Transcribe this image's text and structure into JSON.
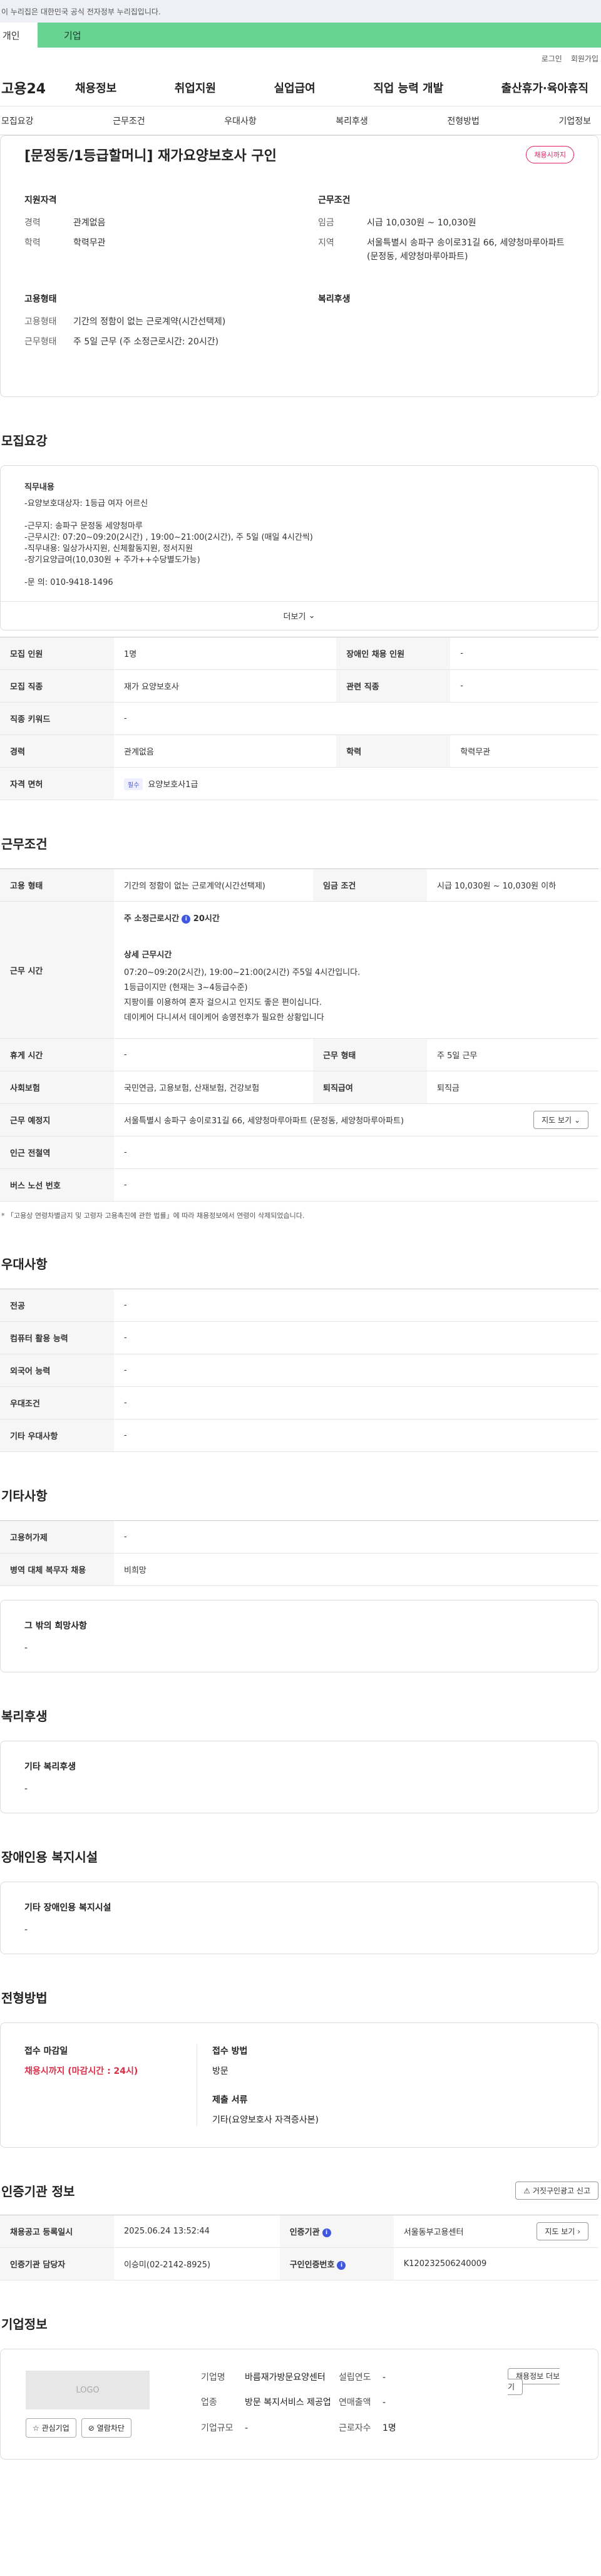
{
  "gov_bar": "이 누리집은 대한민국 공식 전자정부 누리집입니다.",
  "tabs": {
    "person": "개인",
    "company": "기업"
  },
  "util": {
    "login": "로그인",
    "join": "회원가입"
  },
  "logo": "고용24",
  "gnb": [
    "채용정보",
    "취업지원",
    "실업급여",
    "직업 능력 개발",
    "출산휴가·육아휴직"
  ],
  "snb": [
    "모집요강",
    "근무조건",
    "우대사항",
    "복리후생",
    "전형방법",
    "기업정보"
  ],
  "job": {
    "title": "[문정동/1등급할머니] 재가요양보호사 구인",
    "status": "채용시까지",
    "qual_h": "지원자격",
    "qual": [
      [
        "경력",
        "관계없음"
      ],
      [
        "학력",
        "학력무관"
      ]
    ],
    "cond_h": "근무조건",
    "cond": [
      [
        "임금",
        "시급 10,030원 ~ 10,030원"
      ],
      [
        "지역",
        "서울특별시 송파구 송이로31길 66, 세양청마루아파트 (문정동, 세양청마루아파트)"
      ]
    ],
    "emp_h": "고용형태",
    "emp": [
      [
        "고용형태",
        "기간의 정함이 없는 근로계약(시간선택제)"
      ],
      [
        "근무형태",
        "주 5일 근무 (주 소정근로시간: 20시간)"
      ]
    ],
    "welfare_h": "복리후생"
  },
  "recruit": {
    "title": "모집요강",
    "lines": [
      "직무내용",
      "-요양보호대상자: 1등급 여자 어르신",
      "",
      "-근무지: 송파구 문정동 세양청마루",
      "-근무시간: 07:20~09:20(2시간) , 19:00~21:00(2시간), 주 5일 (매일 4시간씩)",
      "-직무내용: 일상가사지원, 신체활동지원, 정서지원",
      "-장기요양급여(10,030원 + 주가++수당별도가능)",
      "",
      "-문 의: 010-9418-1496"
    ],
    "more": "더보기",
    "rows": [
      [
        "모집 인원",
        "1명",
        "장애인 채용 인원",
        "-"
      ],
      [
        "모집 직종",
        "재가 요양보호사",
        "관련 직종",
        "-"
      ],
      [
        "직종 키워드",
        "-"
      ],
      [
        "경력",
        "관계없음",
        "학력",
        "학력무관"
      ],
      [
        "자격 면허",
        "요양보호사1급"
      ]
    ],
    "license_tag": "필수"
  },
  "work": {
    "title": "근무조건",
    "row1": [
      "고용 형태",
      "기간의 정함이 없는 근로계약(시간선택제)",
      "임금 조건",
      "시급 10,030원 ~ 10,030원 이하"
    ],
    "hours_k": "근무 시간",
    "hours_h": "주 소정근로시간",
    "hours_val": "20시간",
    "hours_sub": "상세 근무시간",
    "hours_lines": [
      "07:20~09:20(2시간), 19:00~21:00(2시간) 주5일 4시간입니다.",
      "1등급이지만 (현재는 3~4등급수준)",
      "지팡이를 이용하여 혼자 걸으시고 인지도 좋은 편이십니다.",
      "데이케어 다니셔서 데이케어 송영전후가 필요한 상황입니다"
    ],
    "rows": [
      [
        "휴게 시간",
        "-",
        "근무 형태",
        "주 5일 근무"
      ],
      [
        "사회보험",
        "국민연금, 고용보험, 산재보험, 건강보험",
        "퇴직급여",
        "퇴직금"
      ]
    ],
    "place_k": "근무 예정지",
    "place_v": "서울특별시 송파구 송이로31길 66, 세양청마루아파트 (문정동, 세양청마루아파트)",
    "map_btn": "지도 보기",
    "rows2": [
      [
        "인근 전철역",
        "-"
      ],
      [
        "버스 노선 번호",
        "-"
      ]
    ],
    "note": "* 「고용상 연령차별금지 및 고령자 고용촉진에 관한 법률」에 따라 채용정보에서 연령이 삭제되었습니다."
  },
  "pref": {
    "title": "우대사항",
    "rows": [
      [
        "전공",
        "-"
      ],
      [
        "컴퓨터 활용 능력",
        "-"
      ],
      [
        "외국어 능력",
        "-"
      ],
      [
        "우대조건",
        "-"
      ],
      [
        "기타 우대사항",
        "-"
      ]
    ]
  },
  "etc": {
    "title": "기타사항",
    "rows": [
      [
        "고용허가제",
        "-"
      ],
      [
        "병역 대체 복무자 채용",
        "비희망"
      ]
    ],
    "box_h": "그 밖의 희망사항",
    "box_v": "-"
  },
  "welfare": {
    "title": "복리후생",
    "box_h": "기타 복리후생",
    "box_v": "-"
  },
  "disabled": {
    "title": "장애인용 복지시설",
    "box_h": "기타 장애인용 복지시설",
    "box_v": "-"
  },
  "screening": {
    "title": "전형방법",
    "deadline_h": "접수 마감일",
    "deadline_v": "채용시까지 (마감시간 : 24시)",
    "method_h": "접수 방법",
    "method_v": "방문",
    "docs_h": "제출 서류",
    "docs_v": "기타(요양보호사 자격증사본)"
  },
  "certify": {
    "title": "인증기관 정보",
    "report_btn": "거짓구인광고 신고",
    "rows": [
      [
        "채용공고 등록일시",
        "2025.06.24 13:52:44",
        "인증기관",
        "서울동부고용센터"
      ],
      [
        "인증기관 담당자",
        "이승미(02-2142-8925)",
        "구인인증번호",
        "K120232506240009"
      ]
    ],
    "map_btn": "지도 보기"
  },
  "company": {
    "title": "기업정보",
    "logo": "LOGO",
    "fav_btn": "관심기업",
    "block_btn": "열람차단",
    "list_btn": "채용정보 더보기",
    "name_k": "기업명",
    "name_v": "바름재가방문요양센터",
    "est_k": "설립연도",
    "est_v": "-",
    "ind_k": "업종",
    "ind_v": "방문 복지서비스 제공업",
    "sales_k": "연매출액",
    "sales_v": "-",
    "emp_k": "근로자수",
    "emp_v": "1명",
    "size_k": "기업규모",
    "size_v": "-"
  }
}
